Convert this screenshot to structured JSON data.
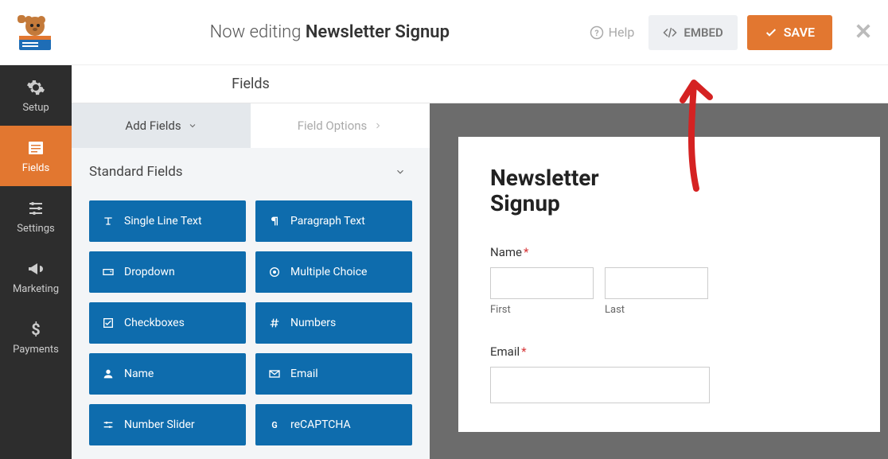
{
  "topbar": {
    "editing_prefix": "Now editing ",
    "form_name": "Newsletter Signup",
    "help_label": "Help",
    "embed_label": "EMBED",
    "save_label": "SAVE"
  },
  "sidebar": {
    "items": [
      {
        "label": "Setup"
      },
      {
        "label": "Fields"
      },
      {
        "label": "Settings"
      },
      {
        "label": "Marketing"
      },
      {
        "label": "Payments"
      }
    ]
  },
  "mid": {
    "header": "Fields",
    "tab_add": "Add Fields",
    "tab_options": "Field Options",
    "accordion_standard": "Standard Fields",
    "fields": [
      {
        "label": "Single Line Text"
      },
      {
        "label": "Paragraph Text"
      },
      {
        "label": "Dropdown"
      },
      {
        "label": "Multiple Choice"
      },
      {
        "label": "Checkboxes"
      },
      {
        "label": "Numbers"
      },
      {
        "label": "Name"
      },
      {
        "label": "Email"
      },
      {
        "label": "Number Slider"
      },
      {
        "label": "reCAPTCHA"
      }
    ]
  },
  "preview": {
    "title_line1": "Newsletter",
    "title_line2": "Signup",
    "name_label": "Name",
    "first_label": "First",
    "last_label": "Last",
    "email_label": "Email"
  },
  "colors": {
    "accent": "#e27730",
    "field_btn": "#0e6cad"
  }
}
